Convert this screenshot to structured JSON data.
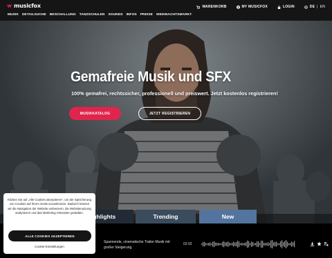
{
  "brand": {
    "name": "musicfox",
    "color": "#e0254d"
  },
  "utility": [
    {
      "icon": "cart-icon",
      "label": "WARENKORB"
    },
    {
      "icon": "user-icon",
      "label": "MY MUSICFOX"
    },
    {
      "icon": "lock-icon",
      "label": "LOGIN"
    }
  ],
  "language": {
    "icon": "globe-icon",
    "active": "DE",
    "separator": "|",
    "other": "EN"
  },
  "nav": [
    "MUSIK",
    "DETAILSUCHE",
    "BESCHALLUNG",
    "TANZSCHULEN",
    "SOUNDS",
    "INFOS",
    "PREISE",
    "WEIHNACHTSMARKT"
  ],
  "hero": {
    "title": "Gemafreie Musik und SFX",
    "subtitle": "100% gemafrei, rechtssicher, professionell und preiswert. Jetzt kostenlos registrieren!",
    "primary_button": "MUSIKKATALOG",
    "secondary_button": "JETZT REGISTRIEREN"
  },
  "tabs": [
    "Highlights",
    "Trending",
    "New"
  ],
  "track": {
    "description": "Spannende, cinematische Trailer-Musik mit großer Steigerung.",
    "duration": "02:02",
    "icons": [
      "download-icon",
      "star-icon",
      "playlist-add-icon"
    ]
  },
  "cookie": {
    "text": "Klicken Sie auf „Alle Cookies akzeptieren\", um der Speicherung von Cookies auf Ihrem Gerät zuzustimmen. Dadurch können wir die Navigation der Website verbessern, die Websitenutzung analysieren und das Marketing relevanter gestalten.",
    "accept_button": "ALLE COOKIES AKZEPTIEREN",
    "settings_link": "Cookie-Einstellungen"
  }
}
